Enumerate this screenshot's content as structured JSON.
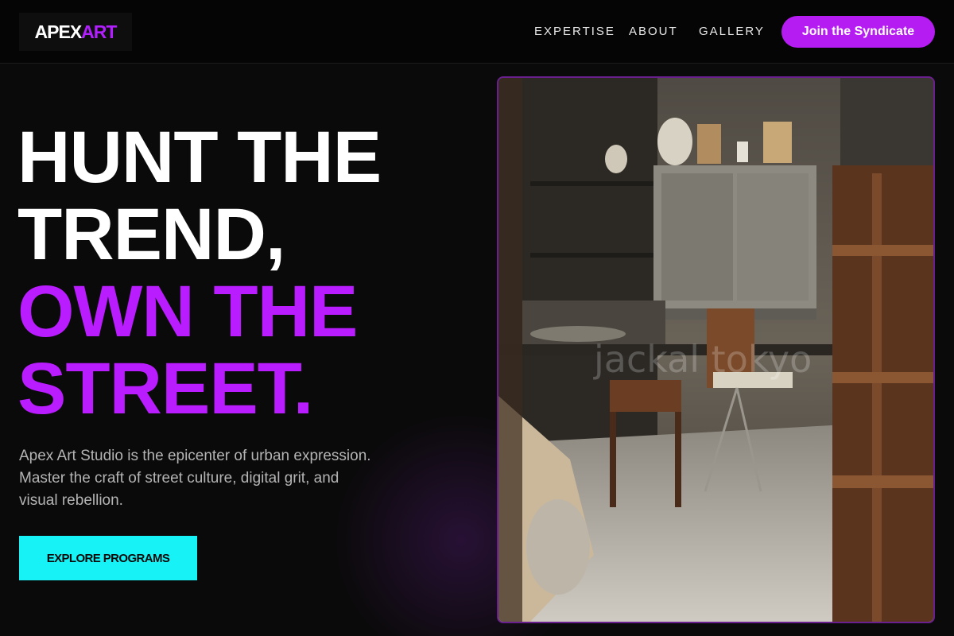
{
  "nav": {
    "logo_part1": "APEX",
    "logo_part2": "ART",
    "links": [
      "EXPERTISE",
      "ABOUT",
      "GALLERY"
    ],
    "cta": "Join the Syndicate"
  },
  "hero": {
    "headline_white": [
      "HUNT THE",
      "TREND,"
    ],
    "headline_purple": [
      "OWN THE",
      "STREET."
    ],
    "description_lines": [
      "Apex Art Studio is the epicenter of urban expression.",
      "Master the craft of street culture, digital grit, and",
      "visual rebellion."
    ],
    "button": "EXPLORE PROGRAMS",
    "image_watermark": "jackal tokyo"
  },
  "colors": {
    "accent_purple": "#b51cf2",
    "accent_cyan": "#16f2f6",
    "background": "#0b0a0b"
  },
  "icons": {
    "hero_image": "art-studio-workshop-photo"
  }
}
